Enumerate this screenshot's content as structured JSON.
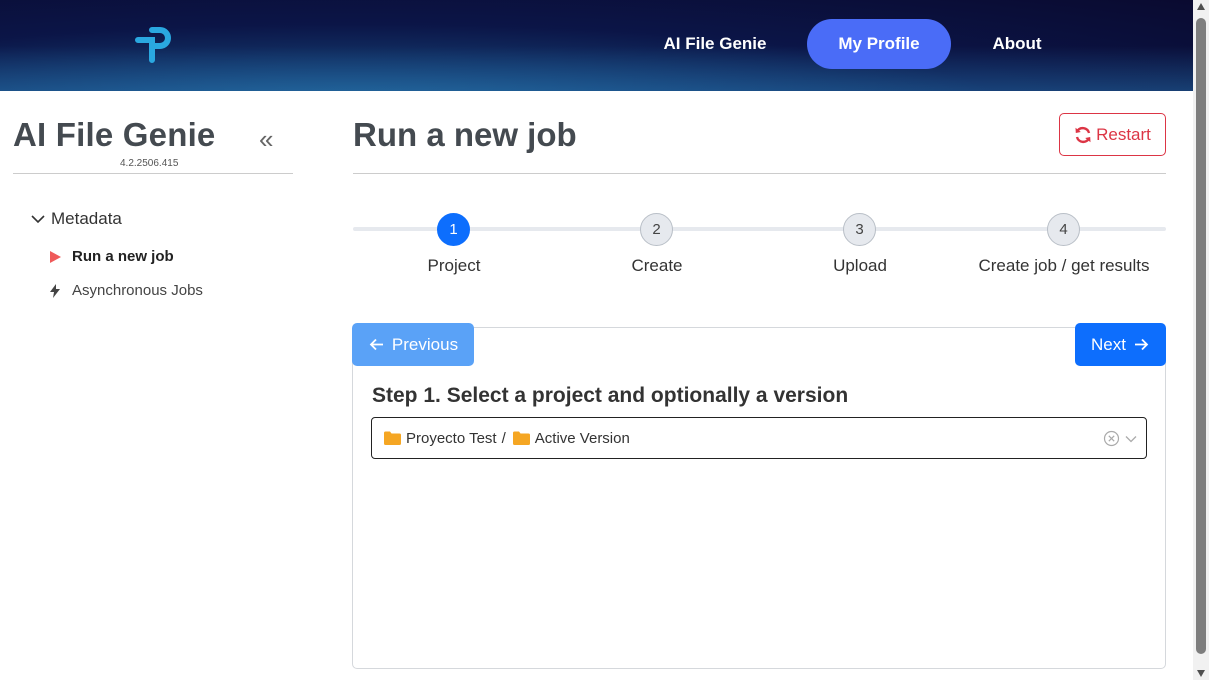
{
  "header": {
    "nav": {
      "ai_file_genie": "AI File Genie",
      "my_profile": "My Profile",
      "about": "About"
    },
    "active_color": "#4a6cf7"
  },
  "sidebar": {
    "title": "AI File Genie",
    "version": "4.2.2506.415",
    "collapse_icon": "double-chevron-left-icon",
    "tree": {
      "root_label": "Metadata",
      "items": [
        {
          "label": "Run a new job",
          "icon": "play-icon",
          "active": true
        },
        {
          "label": "Asynchronous Jobs",
          "icon": "bolt-icon",
          "active": false
        }
      ]
    }
  },
  "main": {
    "title": "Run a new job",
    "restart_label": "Restart",
    "steps": [
      {
        "number": "1",
        "label": "Project",
        "active": true
      },
      {
        "number": "2",
        "label": "Create",
        "active": false
      },
      {
        "number": "3",
        "label": "Upload",
        "active": false
      },
      {
        "number": "4",
        "label": "Create job / get results",
        "active": false
      }
    ],
    "previous_label": "Previous",
    "next_label": "Next",
    "step_heading": "Step 1. Select a project and optionally a version",
    "select": {
      "project": "Proyecto Test",
      "separator": "/",
      "version": "Active Version"
    }
  },
  "colors": {
    "primary": "#0d6efd",
    "danger": "#dc3545",
    "folder": "#f5a623"
  }
}
